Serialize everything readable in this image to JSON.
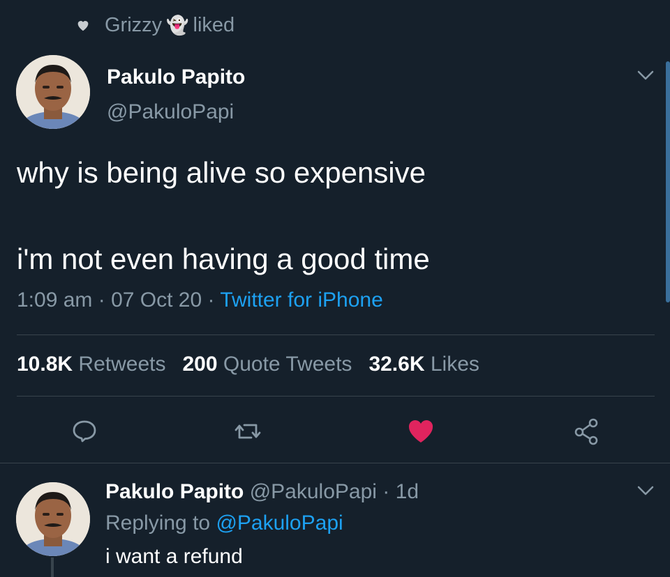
{
  "liked_banner": {
    "user": "Grizzy",
    "emoji": "👻",
    "action": "liked"
  },
  "tweet": {
    "display_name": "Pakulo Papito",
    "handle": "@PakuloPapi",
    "text_line1": "why is being alive so expensive",
    "text_line2": "i'm not even having a good time",
    "time": "1:09 am",
    "date": "07 Oct 20",
    "source": "Twitter for iPhone",
    "separator": "·"
  },
  "stats": {
    "retweets_count": "10.8K",
    "retweets_label": "Retweets",
    "quotes_count": "200",
    "quotes_label": "Quote Tweets",
    "likes_count": "32.6K",
    "likes_label": "Likes"
  },
  "actions": {
    "reply": "reply-icon",
    "retweet": "retweet-icon",
    "like": "heart-filled-icon",
    "share": "share-icon"
  },
  "reply": {
    "display_name": "Pakulo Papito",
    "handle": "@PakuloPapi",
    "separator": "·",
    "age": "1d",
    "replying_to_label": "Replying to",
    "replying_to_handle": "@PakuloPapi",
    "text": "i want a refund"
  },
  "colors": {
    "background": "#15202b",
    "muted": "#8899a6",
    "accent": "#1da1f2",
    "like": "#e0245e",
    "divider": "#38444d"
  }
}
